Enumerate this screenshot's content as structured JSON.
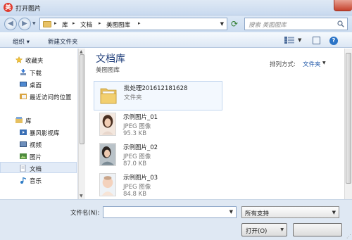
{
  "window": {
    "title": "打开图片",
    "app_icon_glyph": "美"
  },
  "address": {
    "crumbs": [
      "库",
      "文档",
      "美图图库"
    ],
    "search_placeholder": "搜索 美图图库"
  },
  "toolbar": {
    "organize_label": "组织 ▾",
    "new_folder_label": "新建文件夹"
  },
  "sidebar": {
    "items": [
      {
        "label": "收藏夹",
        "icon": "star-icon"
      },
      {
        "label": "下载",
        "icon": "download-icon"
      },
      {
        "label": "桌面",
        "icon": "desktop-icon"
      },
      {
        "label": "最近访问的位置",
        "icon": "recent-places-icon"
      },
      {
        "label": "库",
        "icon": "library-icon"
      },
      {
        "label": "暴风影视库",
        "icon": "video-library-icon"
      },
      {
        "label": "视频",
        "icon": "video-icon"
      },
      {
        "label": "图片",
        "icon": "pictures-icon"
      },
      {
        "label": "文档",
        "icon": "documents-icon",
        "selected": true
      },
      {
        "label": "音乐",
        "icon": "music-icon"
      }
    ]
  },
  "content": {
    "library_title": "文档库",
    "library_subtitle": "美图图库",
    "arrange_label": "排列方式:",
    "arrange_value": "文件夹",
    "files": [
      {
        "name": "批处理201612181628",
        "type": "文件夹",
        "size": "",
        "kind": "folder",
        "selected": true
      },
      {
        "name": "示例图片_01",
        "type": "JPEG 图像",
        "size": "95.3 KB",
        "kind": "image"
      },
      {
        "name": "示例图片_02",
        "type": "JPEG 图像",
        "size": "87.0 KB",
        "kind": "image"
      },
      {
        "name": "示例图片_03",
        "type": "JPEG 图像",
        "size": "84.8 KB",
        "kind": "image"
      }
    ]
  },
  "footer": {
    "filename_label": "文件名(N):",
    "filename_value": "",
    "filter_value": "所有支持",
    "open_label": "打开(O)",
    "cancel_label": ""
  },
  "colors": {
    "accent": "#1e3d7a",
    "link": "#1f57a8",
    "chrome": "#dfe8f3"
  }
}
